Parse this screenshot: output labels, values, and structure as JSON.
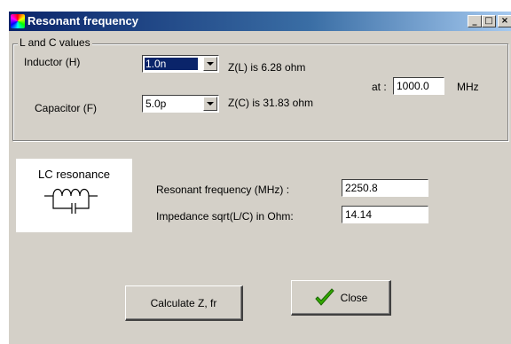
{
  "window": {
    "title": "Resonant frequency",
    "controls": {
      "minimize": "_",
      "maximize": "□",
      "close": "×"
    }
  },
  "group": {
    "label": "L and C values",
    "inductor": {
      "label": "Inductor (H)",
      "value": "1.0n",
      "impedance_text": "Z(L) is 6.28 ohm"
    },
    "capacitor": {
      "label": "Capacitor (F)",
      "value": "5.0p",
      "impedance_text": "Z(C) is 31.83 ohm"
    },
    "frequency": {
      "label": "at :",
      "value": "1000.0",
      "unit": "MHz"
    }
  },
  "lc_panel": {
    "title": "LC resonance",
    "icon": "lc-circuit-icon"
  },
  "results": {
    "resonant_label": "Resonant frequency (MHz) :",
    "resonant_value": "2250.8",
    "impedance_label": "Impedance sqrt(L/C) in Ohm:",
    "impedance_value": "14.14"
  },
  "buttons": {
    "calculate": "Calculate Z, fr",
    "close": "Close"
  },
  "colors": {
    "titlebar": "#0a246a",
    "face": "#d4d0c8",
    "selection": "#0a246a",
    "check": "#33aa00"
  }
}
